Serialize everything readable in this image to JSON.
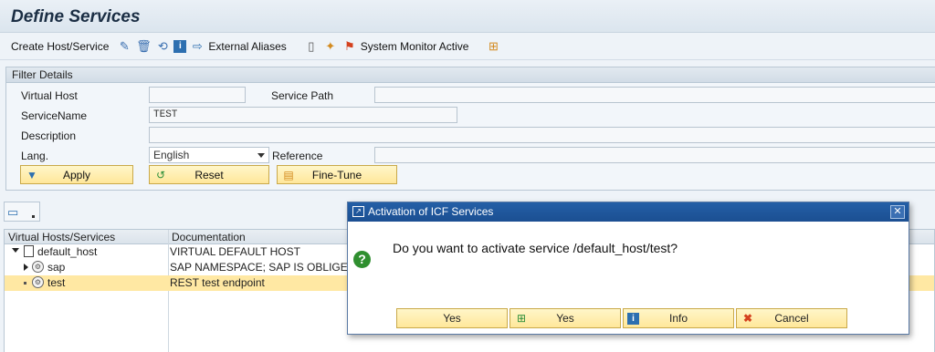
{
  "window": {
    "title": "Define Services"
  },
  "toolbar": {
    "create_label": "Create Host/Service",
    "external_aliases_label": "External Aliases",
    "system_monitor_label": "System Monitor Active"
  },
  "filter": {
    "heading": "Filter Details",
    "virtual_host_label": "Virtual Host",
    "virtual_host_value": "",
    "service_path_label": "Service Path",
    "service_path_value": "",
    "service_name_label": "ServiceName",
    "service_name_value": "TEST",
    "description_label": "Description",
    "description_value": "",
    "lang_label": "Lang.",
    "lang_value": "English",
    "reference_label": "Reference",
    "reference_value": "",
    "apply_label": "Apply",
    "reset_label": "Reset",
    "finetune_label": "Fine-Tune"
  },
  "tree": {
    "col_services": "Virtual Hosts/Services",
    "col_documentation": "Documentation",
    "rows": [
      {
        "name": "default_host",
        "doc": "VIRTUAL DEFAULT HOST"
      },
      {
        "name": "sap",
        "doc": "SAP NAMESPACE; SAP IS OBLIGED NO"
      },
      {
        "name": "test",
        "doc": "REST test endpoint"
      }
    ]
  },
  "dialog": {
    "title": "Activation of ICF Services",
    "message": "Do you want to activate service /default_host/test?",
    "buttons": {
      "yes": "Yes",
      "yes_all": "Yes",
      "info": "Info",
      "cancel": "Cancel"
    }
  },
  "colors": {
    "accent_blue": "#1b4f92",
    "button_yellow": "#ffe79a",
    "selected_row": "#ffe8a3",
    "question_green": "#2f8f2f"
  }
}
